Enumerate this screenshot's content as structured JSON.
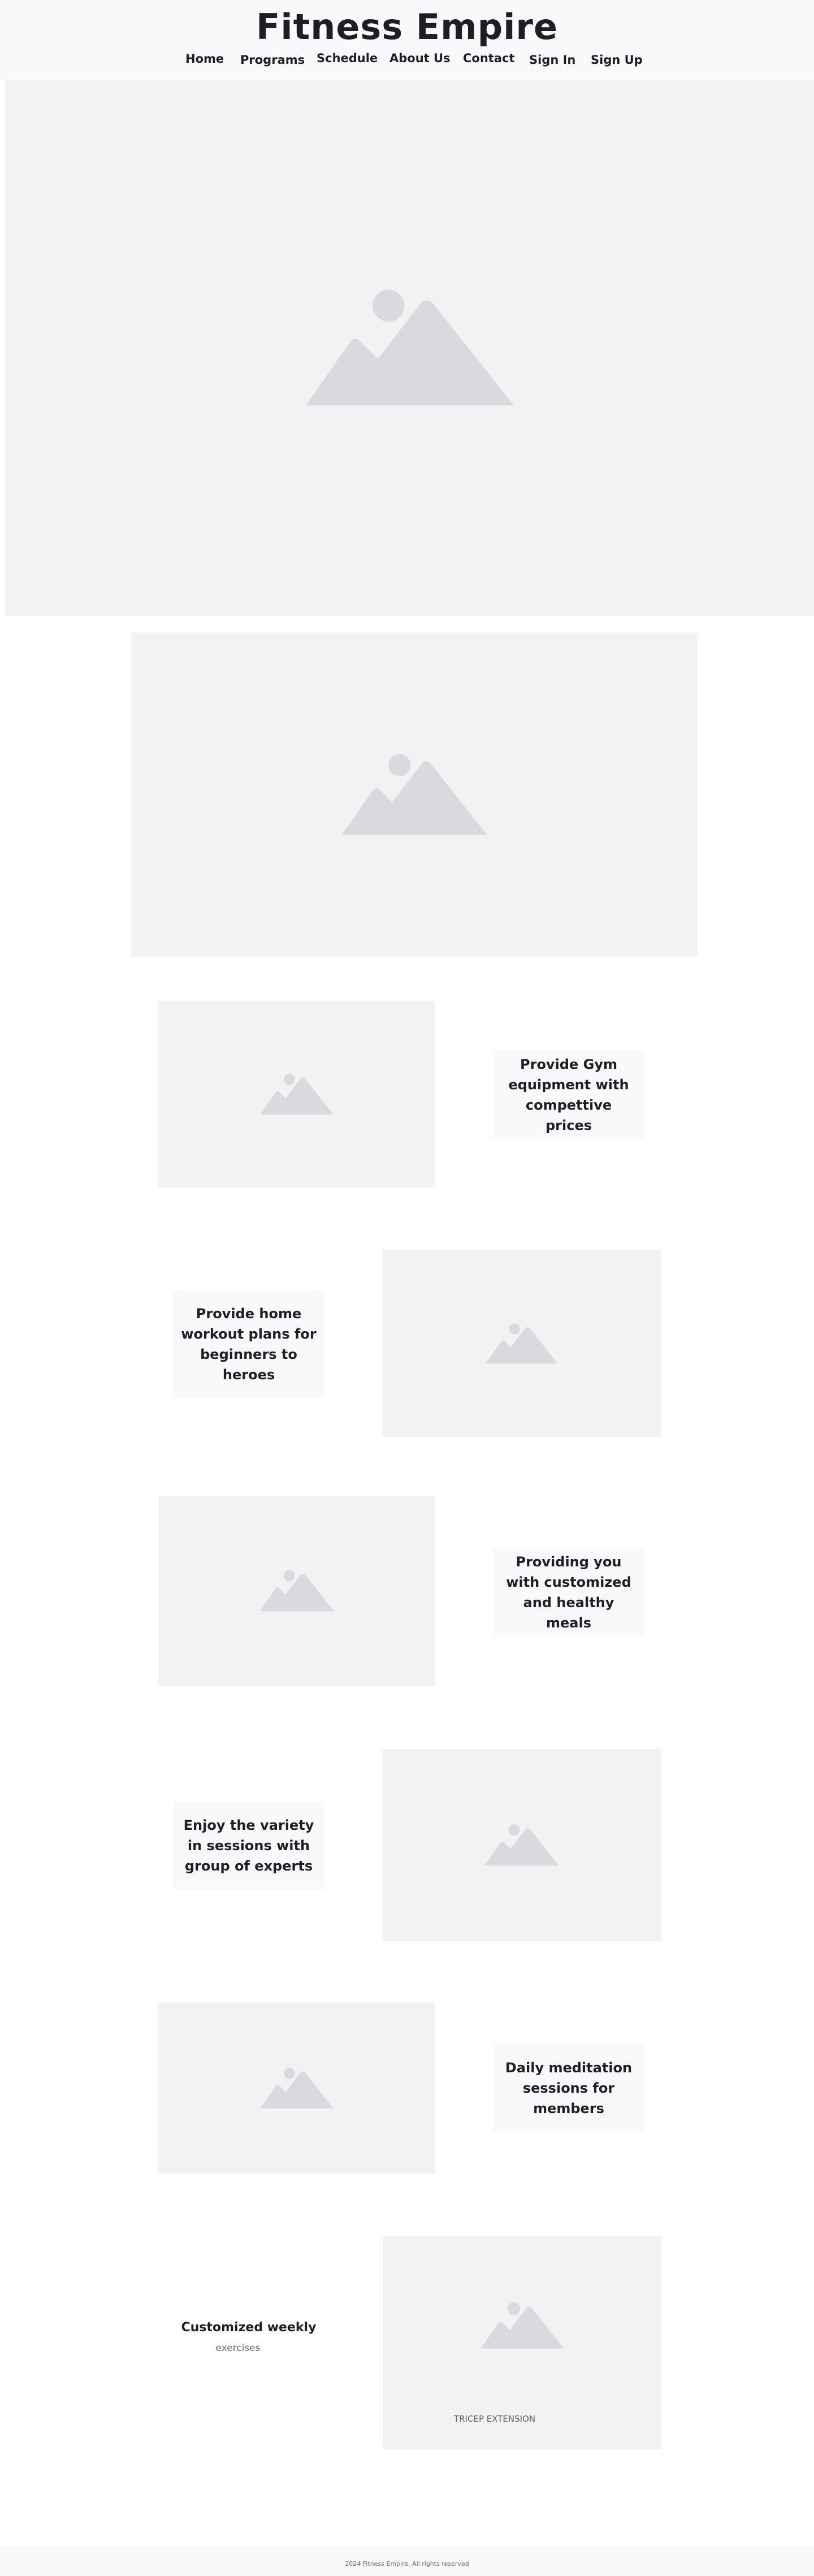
{
  "header": {
    "brand": "Fitness Empire",
    "nav": [
      {
        "label": "Home"
      },
      {
        "label": "Programs"
      },
      {
        "label": "Schedule"
      },
      {
        "label": "About Us"
      },
      {
        "label": "Contact"
      },
      {
        "label": "Sign In"
      },
      {
        "label": "Sign Up"
      }
    ]
  },
  "features": [
    {
      "text": "Provide Gym equipment with compettive prices"
    },
    {
      "text": "Provide home workout plans for beginners to heroes"
    },
    {
      "text": "Providing you with customized and healthy meals"
    },
    {
      "text": "Enjoy the variety in sessions with group of experts"
    },
    {
      "text": "Daily meditation sessions for members"
    }
  ],
  "weekly": {
    "title": "Customized weekly",
    "subtitle": "exercises",
    "image_label": "TRICEP EXTENSION"
  },
  "footer": {
    "text": "2024 Fitness Empire. All rights reserved"
  },
  "colors": {
    "placeholder_bg": "#f2f2f4",
    "placeholder_icon": "#d9dadd",
    "card_bg": "#f8f9fa",
    "text": "#1d1f24"
  },
  "icons": [
    "image-placeholder-icon"
  ]
}
